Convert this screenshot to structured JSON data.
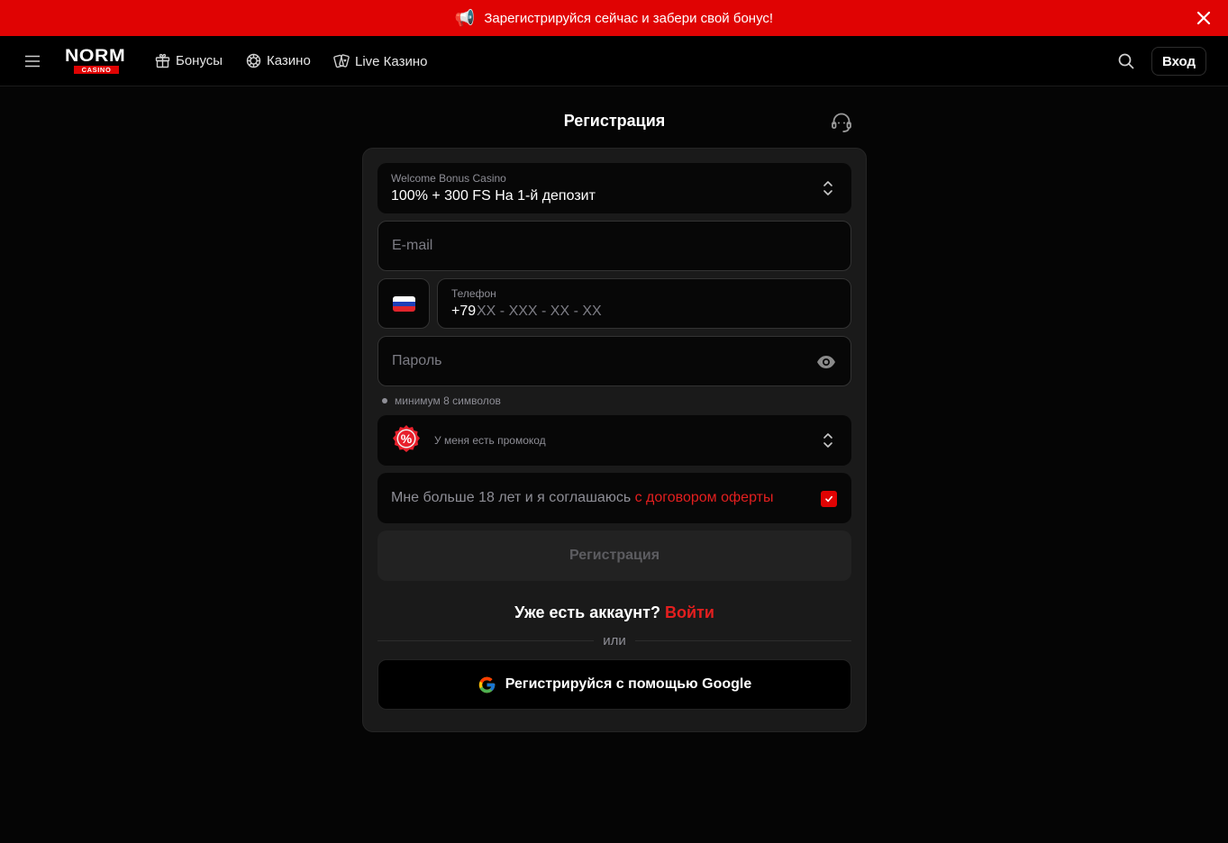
{
  "promo_bar": {
    "icon": "megaphone-icon",
    "text": "Зарегистрируйся сейчас и забери свой бонус!"
  },
  "header": {
    "logo_main": "NORM",
    "logo_sub": "CASINO",
    "nav": [
      {
        "label": "Бонусы",
        "icon": "gift-icon"
      },
      {
        "label": "Казино",
        "icon": "casino-chip-icon"
      },
      {
        "label": "Live Казино",
        "icon": "cards-icon"
      }
    ],
    "login_label": "Вход"
  },
  "page": {
    "title": "Регистрация"
  },
  "form": {
    "bonus": {
      "label": "Welcome Bonus Casino",
      "value": "100% + 300 FS На 1-й депозит"
    },
    "email": {
      "placeholder": "E-mail"
    },
    "phone": {
      "country": "RU",
      "label": "Телефон",
      "prefix": "+79",
      "mask": "XX - XXX - XX - XX"
    },
    "password": {
      "placeholder": "Пароль",
      "hint": "минимум 8 символов"
    },
    "promo": {
      "label": "У меня есть промокод"
    },
    "agreement": {
      "text": "Мне больше 18 лет и я соглашаюсь ",
      "link": "с договором оферты",
      "checked": true
    },
    "submit_label": "Регистрация",
    "have_account": "Уже есть аккаунт?",
    "login_link": "Войти",
    "or": "или",
    "google_label": "Регистрируйся с помощью Google"
  },
  "colors": {
    "accent": "#e00303",
    "background": "#050505",
    "card": "#1a1a1a"
  }
}
